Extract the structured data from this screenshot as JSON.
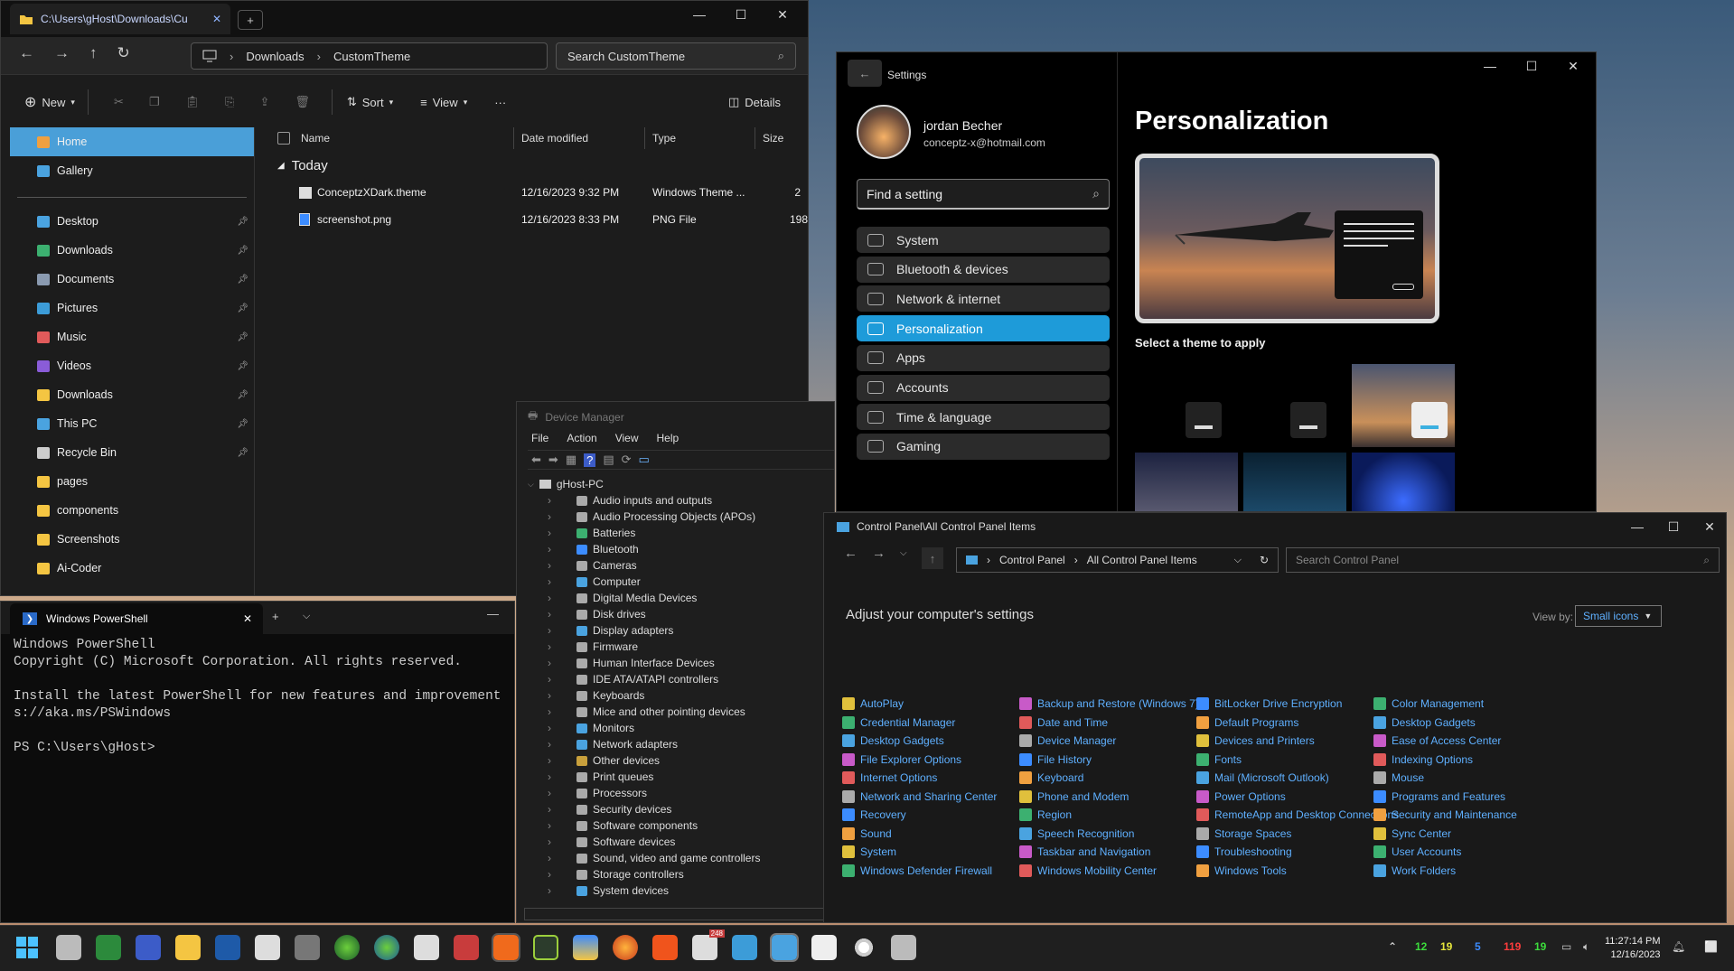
{
  "explorer": {
    "tab_title": "C:\\Users\\gHost\\Downloads\\Cu",
    "breadcrumb": [
      "Downloads",
      "CustomTheme"
    ],
    "search_placeholder": "Search CustomTheme",
    "cmd": {
      "new": "New",
      "sort": "Sort",
      "view": "View",
      "details": "Details",
      "more": "···"
    },
    "sidebar": [
      {
        "label": "Home",
        "icon": "home-icon",
        "pinned": false,
        "selected": true
      },
      {
        "label": "Gallery",
        "icon": "gallery-icon",
        "pinned": false
      },
      {
        "label": "Desktop",
        "icon": "desktop-icon",
        "pinned": true
      },
      {
        "label": "Downloads",
        "icon": "download-icon",
        "pinned": true
      },
      {
        "label": "Documents",
        "icon": "document-icon",
        "pinned": true
      },
      {
        "label": "Pictures",
        "icon": "pictures-icon",
        "pinned": true
      },
      {
        "label": "Music",
        "icon": "music-icon",
        "pinned": true
      },
      {
        "label": "Videos",
        "icon": "videos-icon",
        "pinned": true
      },
      {
        "label": "Downloads",
        "icon": "folder-icon",
        "pinned": true
      },
      {
        "label": "This PC",
        "icon": "pc-icon",
        "pinned": true
      },
      {
        "label": "Recycle Bin",
        "icon": "recycle-bin-icon",
        "pinned": true
      },
      {
        "label": "pages",
        "icon": "folder-icon",
        "pinned": false
      },
      {
        "label": "components",
        "icon": "folder-icon",
        "pinned": false
      },
      {
        "label": "Screenshots",
        "icon": "folder-icon",
        "pinned": false
      },
      {
        "label": "Ai-Coder",
        "icon": "folder-icon",
        "pinned": false
      }
    ],
    "columns": [
      "Name",
      "Date modified",
      "Type",
      "Size"
    ],
    "group": "Today",
    "files": [
      {
        "name": "ConceptzXDark.theme",
        "date": "12/16/2023 9:32 PM",
        "type": "Windows Theme ...",
        "size": "2"
      },
      {
        "name": "screenshot.png",
        "date": "12/16/2023 8:33 PM",
        "type": "PNG File",
        "size": "198"
      }
    ]
  },
  "settings": {
    "title": "Settings",
    "user_name": "jordan Becher",
    "user_email": "conceptz-x@hotmail.com",
    "search_placeholder": "Find a setting",
    "nav": [
      {
        "label": "System",
        "icon": "system-icon"
      },
      {
        "label": "Bluetooth & devices",
        "icon": "bluetooth-icon"
      },
      {
        "label": "Network & internet",
        "icon": "wifi-icon"
      },
      {
        "label": "Personalization",
        "icon": "brush-icon",
        "selected": true
      },
      {
        "label": "Apps",
        "icon": "apps-icon"
      },
      {
        "label": "Accounts",
        "icon": "person-icon"
      },
      {
        "label": "Time & language",
        "icon": "globe-icon"
      },
      {
        "label": "Gaming",
        "icon": "gamepad-icon"
      }
    ],
    "page_title": "Personalization",
    "theme_caption": "Select a theme to apply"
  },
  "devmgr": {
    "title": "Device Manager",
    "menu": [
      "File",
      "Action",
      "View",
      "Help"
    ],
    "root": "gHost-PC",
    "items": [
      "Audio inputs and outputs",
      "Audio Processing Objects (APOs)",
      "Batteries",
      "Bluetooth",
      "Cameras",
      "Computer",
      "Digital Media Devices",
      "Disk drives",
      "Display adapters",
      "Firmware",
      "Human Interface Devices",
      "IDE ATA/ATAPI controllers",
      "Keyboards",
      "Mice and other pointing devices",
      "Monitors",
      "Network adapters",
      "Other devices",
      "Print queues",
      "Processors",
      "Security devices",
      "Software components",
      "Software devices",
      "Sound, video and game controllers",
      "Storage controllers",
      "System devices"
    ]
  },
  "controlpanel": {
    "title": "Control Panel\\All Control Panel Items",
    "crumbs": [
      "Control Panel",
      "All Control Panel Items"
    ],
    "search_placeholder": "Search Control Panel",
    "heading": "Adjust your computer's settings",
    "view_by_label": "View by:",
    "view_by_value": "Small icons",
    "columns": [
      [
        "AutoPlay",
        "Credential Manager",
        "Desktop Gadgets",
        "File Explorer Options",
        "Internet Options",
        "Network and Sharing Center",
        "Recovery",
        "Sound",
        "System",
        "Windows Defender Firewall"
      ],
      [
        "Backup and Restore (Windows 7)",
        "Date and Time",
        "Device Manager",
        "File History",
        "Keyboard",
        "Phone and Modem",
        "Region",
        "Speech Recognition",
        "Taskbar and Navigation",
        "Windows Mobility Center"
      ],
      [
        "BitLocker Drive Encryption",
        "Default Programs",
        "Devices and Printers",
        "Fonts",
        "Mail (Microsoft Outlook)",
        "Power Options",
        "RemoteApp and Desktop Connections",
        "Storage Spaces",
        "Troubleshooting",
        "Windows Tools"
      ],
      [
        "Color Management",
        "Desktop Gadgets",
        "Ease of Access Center",
        "Indexing Options",
        "Mouse",
        "Programs and Features",
        "Security and Maintenance",
        "Sync Center",
        "User Accounts",
        "Work Folders"
      ]
    ]
  },
  "powershell": {
    "tab_title": "Windows PowerShell",
    "lines": [
      "Windows PowerShell",
      "Copyright (C) Microsoft Corporation. All rights reserved.",
      "",
      "Install the latest PowerShell for new features and improvement",
      "s://aka.ms/PSWindows",
      "",
      "PS C:\\Users\\gHost>"
    ]
  },
  "taskbar": {
    "tray": [
      {
        "t": "12",
        "c": "#3cdc3c"
      },
      {
        "t": "19",
        "c": "#e6e63c"
      },
      {
        "t": "5",
        "c": "#3c8cff"
      },
      {
        "t": "119",
        "c": "#ff3c3c"
      },
      {
        "t": "19",
        "c": "#3cdc3c"
      }
    ],
    "time": "11:27:14 PM",
    "date": "12/16/2023",
    "badge": "248"
  }
}
